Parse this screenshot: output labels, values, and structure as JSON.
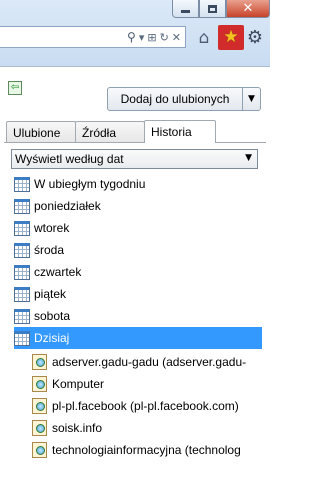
{
  "toolbar": {
    "icons": {
      "search": "search-icon",
      "refresh": "refresh-icon",
      "stop": "stop-icon",
      "home": "home-icon",
      "favorites": "star-icon",
      "tools": "gear-icon"
    },
    "favorites_highlight": "#d12b2b",
    "star_color": "#f4c21e"
  },
  "panel": {
    "add_button_label": "Dodaj do ulubionych",
    "tabs": [
      {
        "label": "Ulubione",
        "active": false
      },
      {
        "label": "Źródła",
        "active": false
      },
      {
        "label": "Historia",
        "active": true
      }
    ],
    "view_select": {
      "selected": "Wyświetl według dat"
    },
    "history": {
      "days": [
        "W ubiegłym tygodniu",
        "poniedziałek",
        "wtorek",
        "środa",
        "czwartek",
        "piątek",
        "sobota",
        "Dzisiaj"
      ],
      "selected_day": "Dzisiaj",
      "selection_color": "#3399ff",
      "today_sites": [
        "adserver.gadu-gadu (adserver.gadu-",
        "Komputer",
        "pl-pl.facebook (pl-pl.facebook.com)",
        "soisk.info",
        "technologiainformacyjna (technolog"
      ]
    }
  }
}
